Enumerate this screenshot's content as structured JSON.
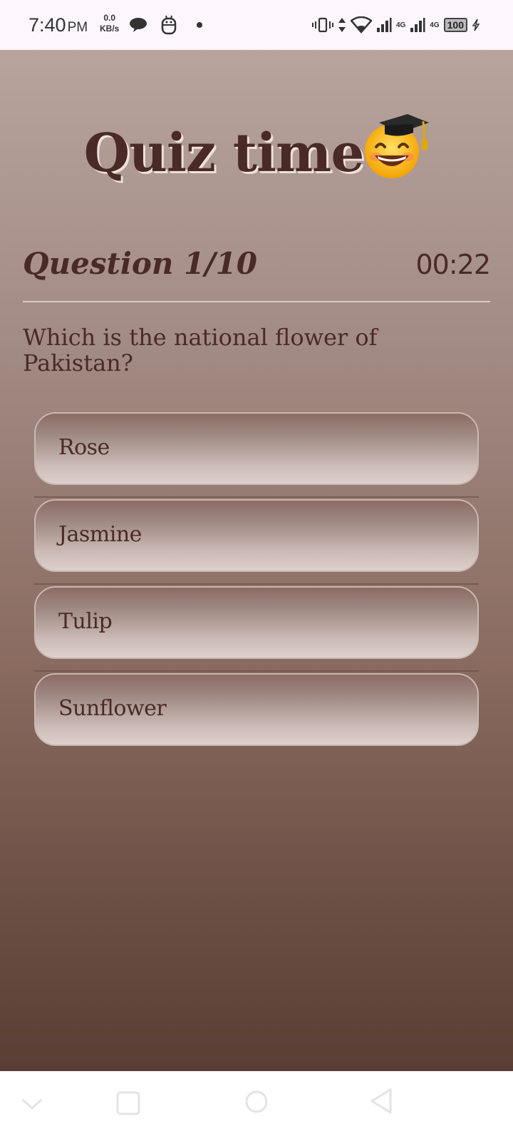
{
  "status_bar": {
    "time": "7:40",
    "ampm": "PM",
    "speed_value": "0.0",
    "speed_unit": "KB/s",
    "network_label_1": "4G",
    "network_label_2": "4G",
    "battery": "100",
    "icons": [
      "chat-icon",
      "robot-icon",
      "vibrate-icon",
      "data-arrows-icon",
      "wifi-icon",
      "signal-icon",
      "battery-icon",
      "charging-icon"
    ]
  },
  "app": {
    "title": "Quiz time",
    "title_emoji": "graduate-smiley-emoji",
    "question_counter": "Question 1/10",
    "timer": "00:22",
    "question": "Which is the national flower of Pakistan?",
    "options": [
      {
        "label": "Rose"
      },
      {
        "label": "Jasmine"
      },
      {
        "label": "Tulip"
      },
      {
        "label": "Sunflower"
      }
    ],
    "colors": {
      "text": "#4a2a26",
      "gradient_top": "#b8a39d",
      "gradient_bottom": "#5a3e35"
    }
  },
  "nav_bar": {
    "buttons": [
      "back-icon",
      "recents-icon",
      "home-icon",
      "triangle-back-icon"
    ]
  }
}
